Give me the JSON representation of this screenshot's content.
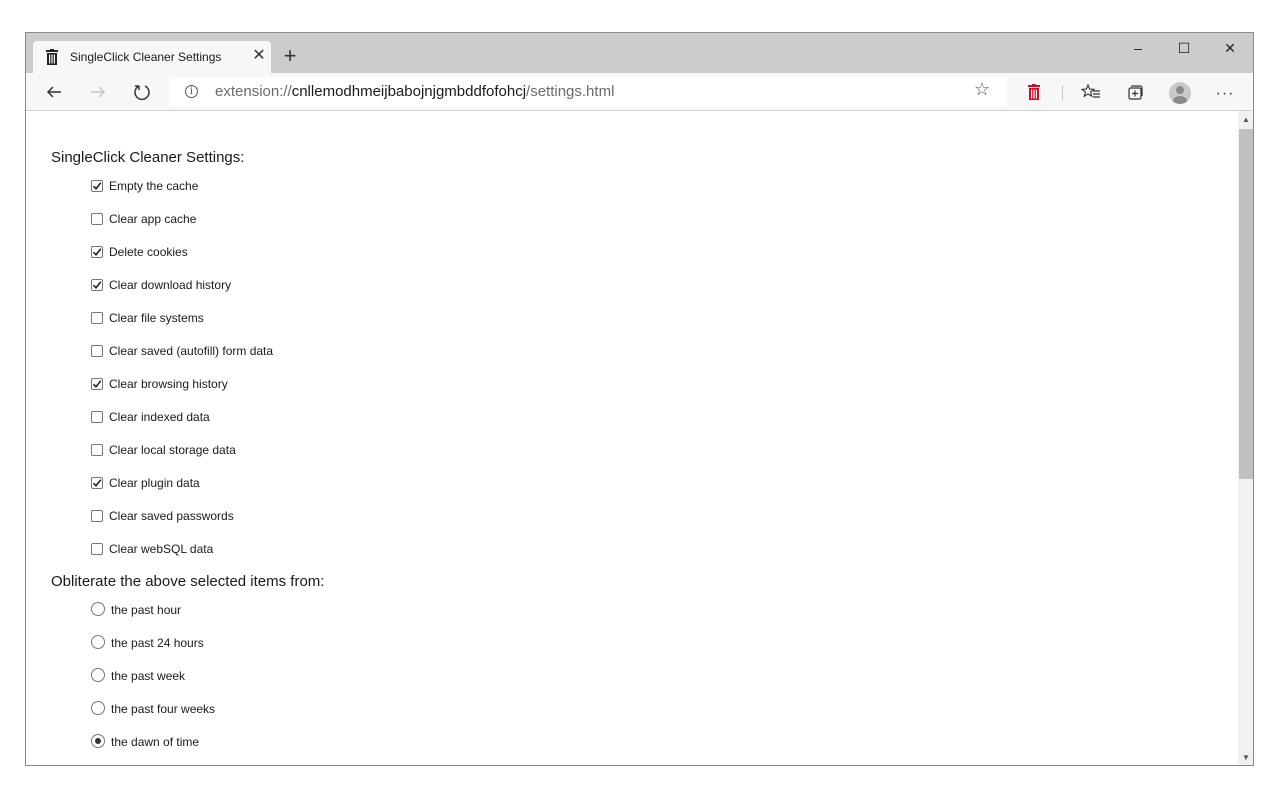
{
  "browser": {
    "tab_title": "SingleClick Cleaner Settings",
    "tab_close": "✕",
    "new_tab": "+",
    "url_scheme": "extension://",
    "url_host": "cnllemodhmeijbabojnjgmbddfofohcj",
    "url_path": "/settings.html",
    "controls": {
      "minimize": "–",
      "maximize": "☐",
      "close": "✕"
    },
    "extension_icon_color": "#c8102e"
  },
  "page": {
    "settings_heading": "SingleClick Cleaner Settings:",
    "checkbox_options": [
      {
        "label": "Empty the cache",
        "checked": true
      },
      {
        "label": "Clear app cache",
        "checked": false
      },
      {
        "label": "Delete cookies",
        "checked": true
      },
      {
        "label": "Clear download history",
        "checked": true
      },
      {
        "label": "Clear file systems",
        "checked": false
      },
      {
        "label": "Clear saved (autofill) form data",
        "checked": false
      },
      {
        "label": "Clear browsing history",
        "checked": true
      },
      {
        "label": "Clear indexed data",
        "checked": false
      },
      {
        "label": "Clear local storage data",
        "checked": false
      },
      {
        "label": "Clear plugin data",
        "checked": true
      },
      {
        "label": "Clear saved passwords",
        "checked": false
      },
      {
        "label": "Clear webSQL data",
        "checked": false
      }
    ],
    "timeframe_heading": "Obliterate the above selected items from:",
    "radio_options": [
      {
        "label": "the past hour",
        "selected": false
      },
      {
        "label": "the past 24 hours",
        "selected": false
      },
      {
        "label": "the past week",
        "selected": false
      },
      {
        "label": "the past four weeks",
        "selected": false
      },
      {
        "label": "the dawn of time",
        "selected": true
      }
    ]
  }
}
